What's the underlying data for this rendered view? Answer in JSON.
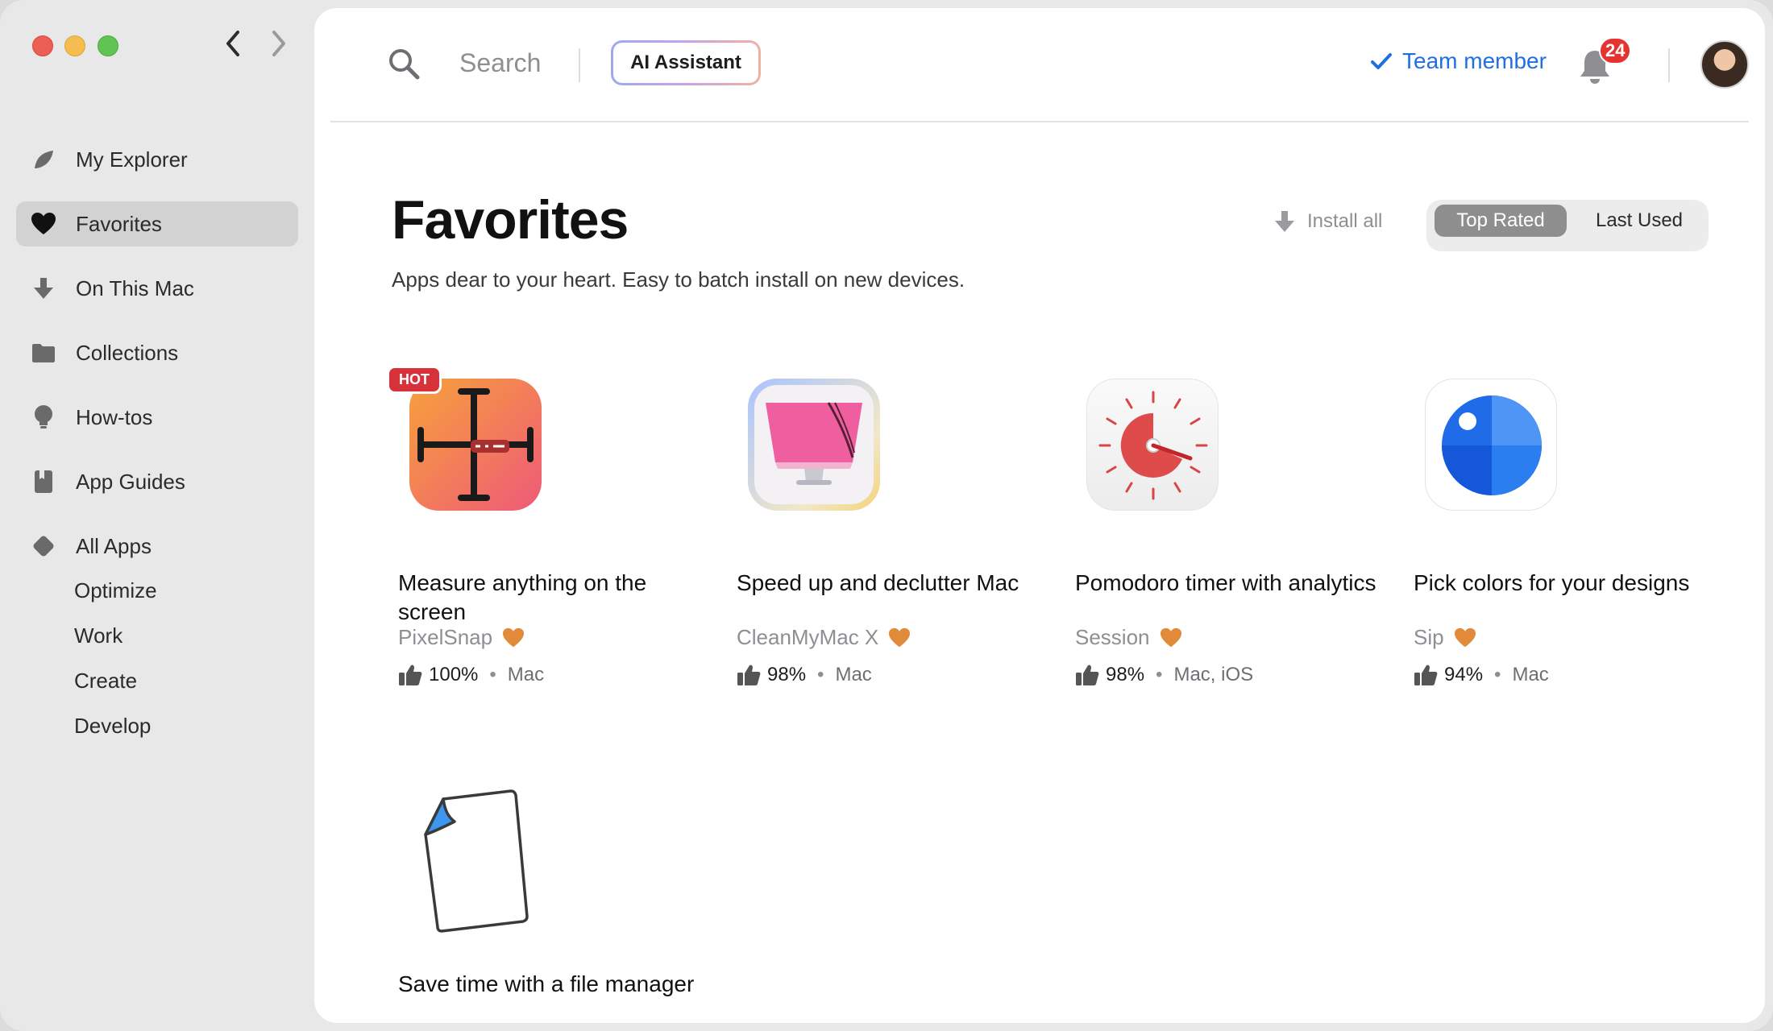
{
  "sidebar": {
    "items": [
      {
        "label": "My Explorer",
        "icon": "leaf-icon"
      },
      {
        "label": "Favorites",
        "icon": "heart-icon"
      },
      {
        "label": "On This Mac",
        "icon": "download-arrow-icon"
      },
      {
        "label": "Collections",
        "icon": "folder-icon"
      },
      {
        "label": "How-tos",
        "icon": "lightbulb-icon"
      },
      {
        "label": "App Guides",
        "icon": "book-icon"
      },
      {
        "label": "All Apps",
        "icon": "diamond-icon"
      }
    ],
    "subitems": [
      "Optimize",
      "Work",
      "Create",
      "Develop"
    ]
  },
  "topbar": {
    "search_label": "Search",
    "ai_assistant": "AI Assistant",
    "team_member": "Team member",
    "notification_count": "24"
  },
  "page": {
    "title": "Favorites",
    "subtitle": "Apps dear to your heart. Easy to batch install on new devices.",
    "install_all": "Install all",
    "sort_options": [
      "Top Rated",
      "Last Used"
    ],
    "selected_sort": "Top Rated"
  },
  "apps": [
    {
      "title": "Measure anything on the screen",
      "name": "PixelSnap",
      "rating": "100%",
      "platforms": "Mac",
      "badge": "HOT",
      "icon": "ruler-crosshair-icon"
    },
    {
      "title": "Speed up and declutter Mac",
      "name": "CleanMyMac X",
      "rating": "98%",
      "platforms": "Mac",
      "icon": "imac-broom-icon"
    },
    {
      "title": "Pomodoro timer with analytics",
      "name": "Session",
      "rating": "98%",
      "platforms": "Mac, iOS",
      "icon": "timer-icon"
    },
    {
      "title": "Pick colors for your designs",
      "name": "Sip",
      "rating": "94%",
      "platforms": "Mac",
      "icon": "color-picker-icon"
    },
    {
      "title": "Save time with a file manager",
      "icon": "file-page-icon"
    }
  ],
  "colors": {
    "accent": "#1f6fe0",
    "heart": "#e08a3a",
    "badge": "#e3342f",
    "hot": "#d7323a"
  }
}
